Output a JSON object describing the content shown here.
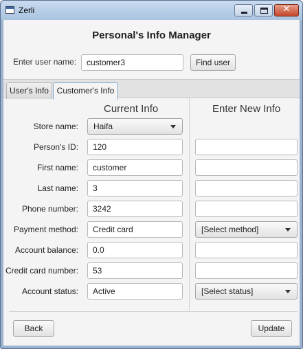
{
  "window": {
    "title": "Zerli"
  },
  "header": {
    "title": "Personal's Info Manager",
    "user_label": "Enter user name:",
    "user_value": "customer3",
    "find_button": "Find user"
  },
  "tabs": [
    {
      "label": "User's Info",
      "selected": false
    },
    {
      "label": "Customer's Info",
      "selected": true
    }
  ],
  "columns": {
    "current": "Current Info",
    "new": "Enter New Info"
  },
  "form": {
    "store": {
      "label": "Store name:",
      "current": "Haifa"
    },
    "person_id": {
      "label": "Person's ID:",
      "current": "120",
      "new": ""
    },
    "first_name": {
      "label": "First name:",
      "current": "customer",
      "new": ""
    },
    "last_name": {
      "label": "Last name:",
      "current": "3",
      "new": ""
    },
    "phone": {
      "label": "Phone number:",
      "current": "3242",
      "new": ""
    },
    "payment": {
      "label": "Payment method:",
      "current": "Credit card",
      "new": "[Select method]"
    },
    "balance": {
      "label": "Account balance:",
      "current": "0.0",
      "new": ""
    },
    "card": {
      "label": "Credit card number:",
      "current": "53",
      "new": ""
    },
    "status": {
      "label": "Account status:",
      "current": "Active",
      "new": "[Select status]"
    }
  },
  "footer": {
    "back_button": "Back",
    "update_button": "Update"
  }
}
